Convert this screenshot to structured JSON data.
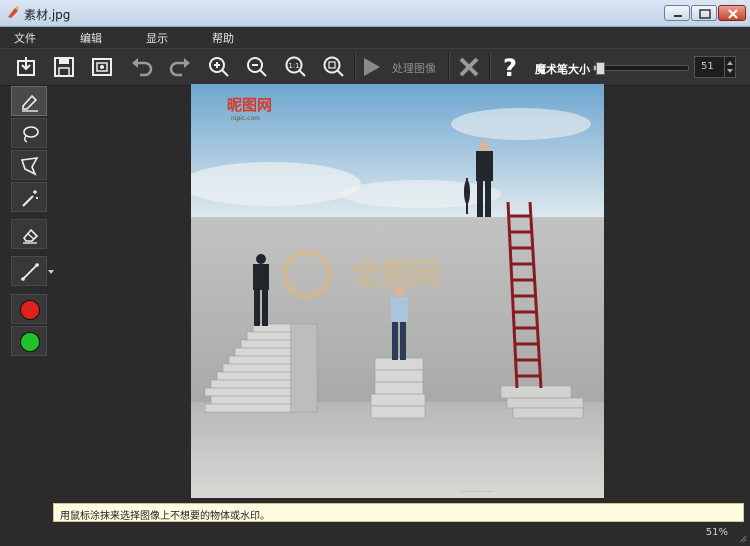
{
  "window": {
    "title": "素材.jpg"
  },
  "menu": {
    "items": [
      "文件",
      "编辑",
      "显示",
      "帮助"
    ]
  },
  "toolbar": {
    "process_label": "处理图像",
    "help_label": "?",
    "brush_size_label": "魔术笔大小",
    "brush_size_value": "51",
    "brush_size_fraction": 0.06
  },
  "sidebar": {
    "colors": {
      "red": "#e0201c",
      "green": "#22c22a"
    }
  },
  "status": {
    "message": "用鼠标涂抹来选择图像上不想要的物体或水印。",
    "zoom": "51%"
  },
  "photo": {
    "logo_text": "昵图网",
    "logo_sub": "nipic.com"
  }
}
